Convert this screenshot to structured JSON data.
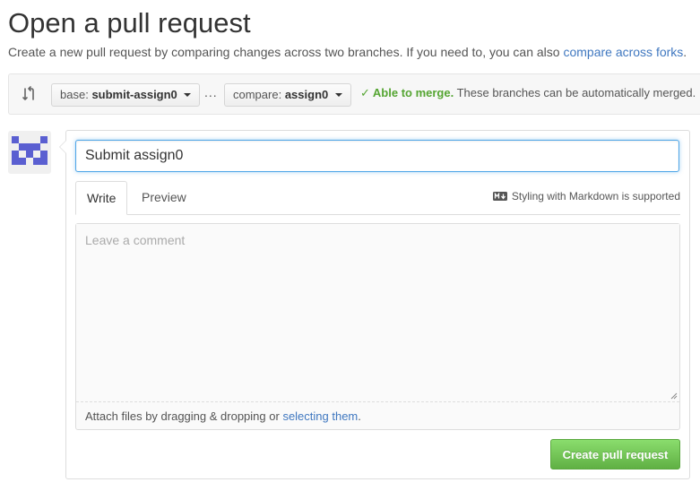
{
  "header": {
    "title": "Open a pull request",
    "subtitle": "Create a new pull request by comparing changes across two branches. If you need to, you can also",
    "forks_link": "compare across forks",
    "subtitle_end": "."
  },
  "range": {
    "base_prefix": "base:",
    "base_branch": "submit-assign0",
    "ellipsis": "...",
    "compare_prefix": "compare:",
    "compare_branch": "assign0",
    "merge_check": "✓",
    "merge_ok": "Able to merge.",
    "merge_detail": "These branches can be automatically merged."
  },
  "form": {
    "title_value": "Submit assign0",
    "tabs": [
      {
        "label": "Write",
        "active": true
      },
      {
        "label": "Preview",
        "active": false
      }
    ],
    "markdown_note": "Styling with Markdown is supported",
    "comment_placeholder": "Leave a comment",
    "attach_text": "Attach files by dragging & dropping or",
    "attach_link": "selecting them",
    "attach_end": ".",
    "submit_label": "Create pull request"
  },
  "colors": {
    "link": "#4078c0",
    "success": "#55a532",
    "button_green_top": "#8add6d",
    "button_green_bottom": "#60b044",
    "focus_border": "#51a7e8",
    "avatar_identicon": "#5a5fd1"
  },
  "icons": {
    "compare": "git-compare-icon",
    "markdown": "markdown-icon",
    "check": "check-icon",
    "avatar": "identicon-avatar"
  }
}
